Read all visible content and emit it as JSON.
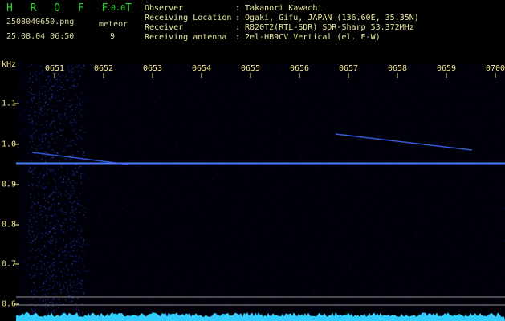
{
  "app": {
    "name": "H R O F F T",
    "version": "1.0.0"
  },
  "file": {
    "name": "2508040650.png",
    "datetime": "25.08.04 06:50"
  },
  "meteor": {
    "label": "meteor",
    "count": "9"
  },
  "info": [
    {
      "key": "Observer",
      "value": ": Takanori Kawachi"
    },
    {
      "key": "Receiving Location",
      "value": ": Ogaki, Gifu, JAPAN (136.60E, 35.35N)"
    },
    {
      "key": "Receiver",
      "value": ": R820T2(RTL-SDR) SDR-Sharp 53.372MHz"
    },
    {
      "key": "Receiving antenna",
      "value": ": 2el-HB9CV Vertical (el. E-W)"
    }
  ],
  "axis": {
    "y_unit": "kHz",
    "x_ticks": [
      "0651",
      "0652",
      "0653",
      "0654",
      "0655",
      "0656",
      "0657",
      "0658",
      "0659",
      "0700"
    ],
    "y_ticks": [
      "1.1",
      "1.0",
      "0.9",
      "0.8",
      "0.7",
      "0.6"
    ]
  },
  "colors": {
    "background": "#000000",
    "noise": "#1a1a8c",
    "carrier": "#4a7dff",
    "meteor_trace": "#3f6bff",
    "baseline": "#33ccff",
    "ref_line": "#c8c8c8",
    "tick": "#f0e68c"
  }
}
